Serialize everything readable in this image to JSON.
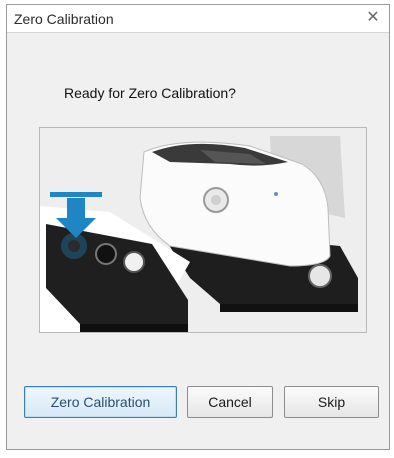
{
  "window": {
    "title": "Zero Calibration",
    "close_icon": "close-x-icon"
  },
  "main": {
    "prompt": "Ready for Zero Calibration?",
    "illustration": "calibration-device-illustration"
  },
  "buttons": {
    "zero_calibration": "Zero Calibration",
    "cancel": "Cancel",
    "skip": "Skip"
  },
  "colors": {
    "dialog_bg": "#f0f0f0",
    "accent_arrow": "#1f86c6",
    "default_button_border": "#3c7fb1"
  }
}
